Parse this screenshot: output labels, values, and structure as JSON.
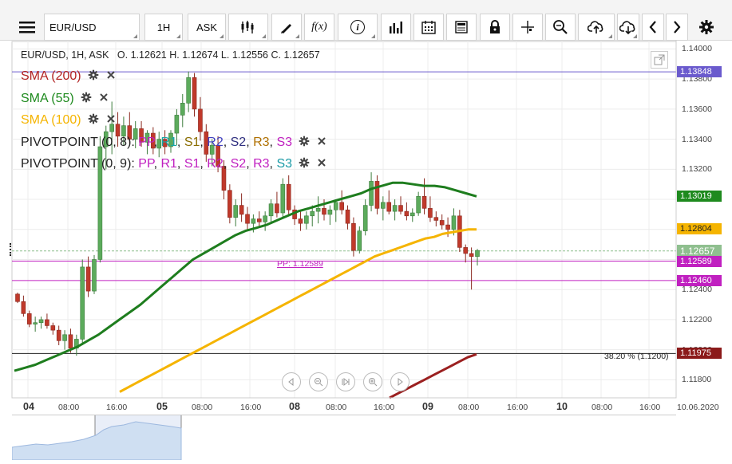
{
  "toolbar": {
    "symbol": "EUR/USD",
    "interval": "1H",
    "price_type": "ASK",
    "icons": [
      "menu-icon",
      "candlestick-icon",
      "draw-icon",
      "fx-icon",
      "info-icon",
      "volume-icon",
      "calendar-icon",
      "template-icon",
      "lock-icon",
      "crosshair-icon",
      "zoom-icon",
      "upload-icon",
      "download-icon",
      "chevron-left-icon",
      "chevron-right-icon",
      "gear-icon"
    ],
    "fx_label": "f(x)",
    "info_label": "i"
  },
  "ohlc": {
    "text": "EUR/USD, 1H, ASK",
    "open_label": "O.",
    "open": "1.12621",
    "high_label": "H.",
    "high": "1.12674",
    "low_label": "L.",
    "low": "1.12556",
    "close_label": "C.",
    "close": "1.12657"
  },
  "indicators": [
    {
      "label": "SMA (200)",
      "color": "#b22222"
    },
    {
      "label": "SMA (55)",
      "color": "#1e8a1e"
    },
    {
      "label": "SMA (100)",
      "color": "#f5b400"
    }
  ],
  "pivots": [
    {
      "prefix": "PIVOTPOINT (0, 8)",
      "parts": [
        {
          "t": ": ",
          "c": "#222"
        },
        {
          "t": "PP",
          "c": "#c020c0"
        },
        {
          "t": ", ",
          "c": "#222"
        },
        {
          "t": "R1",
          "c": "#1aa6a6"
        },
        {
          "t": ", ",
          "c": "#222"
        },
        {
          "t": "S1",
          "c": "#8a6d00"
        },
        {
          "t": ", ",
          "c": "#222"
        },
        {
          "t": "R2",
          "c": "#4040c0"
        },
        {
          "t": ", ",
          "c": "#222"
        },
        {
          "t": "S2",
          "c": "#303080"
        },
        {
          "t": ", ",
          "c": "#222"
        },
        {
          "t": "R3",
          "c": "#b07000"
        },
        {
          "t": ", ",
          "c": "#222"
        },
        {
          "t": "S3",
          "c": "#c020c0"
        }
      ]
    },
    {
      "prefix": "PIVOTPOINT (0, 9)",
      "parts": [
        {
          "t": ": ",
          "c": "#222"
        },
        {
          "t": "PP",
          "c": "#c020c0"
        },
        {
          "t": ", ",
          "c": "#222"
        },
        {
          "t": "R1",
          "c": "#c020c0"
        },
        {
          "t": ", ",
          "c": "#222"
        },
        {
          "t": "S1",
          "c": "#c020c0"
        },
        {
          "t": ", ",
          "c": "#222"
        },
        {
          "t": "R2",
          "c": "#c020c0"
        },
        {
          "t": ", ",
          "c": "#222"
        },
        {
          "t": "S2",
          "c": "#c020c0"
        },
        {
          "t": ", ",
          "c": "#222"
        },
        {
          "t": "R3",
          "c": "#c020c0"
        },
        {
          "t": ", ",
          "c": "#222"
        },
        {
          "t": "S3",
          "c": "#1a9aa6"
        }
      ]
    }
  ],
  "y_axis": {
    "ticks": [
      "1.14000",
      "1.13800",
      "1.13600",
      "1.13400",
      "1.13200",
      "1.13000",
      "1.12800",
      "1.12600",
      "1.12400",
      "1.12200",
      "1.12000",
      "1.11800"
    ],
    "range": [
      1.1168,
      1.1405
    ]
  },
  "price_tags": [
    {
      "value": "1.13848",
      "bg": "#6a5acd",
      "fg": "#ffffff"
    },
    {
      "value": "1.13019",
      "bg": "#1e8a1e",
      "fg": "#ffffff"
    },
    {
      "value": "1.12804",
      "bg": "#f5b400",
      "fg": "#222222"
    },
    {
      "value": "1.12657",
      "bg": "#8fbf8f",
      "fg": "#ffffff"
    },
    {
      "value": "1.12589",
      "bg": "#c020c0",
      "fg": "#ffffff"
    },
    {
      "value": "1.12460",
      "bg": "#c020c0",
      "fg": "#ffffff"
    },
    {
      "value": "1.11975",
      "bg": "#8b1a1a",
      "fg": "#ffffff"
    }
  ],
  "annotations": {
    "pp_label": "PP: 1.12589",
    "fib_label": "38.20 % (1.1200)"
  },
  "x_axis": {
    "labels": [
      {
        "t": "04",
        "day": true
      },
      {
        "t": "08:00",
        "day": false
      },
      {
        "t": "16:00",
        "day": false
      },
      {
        "t": "05",
        "day": true
      },
      {
        "t": "08:00",
        "day": false
      },
      {
        "t": "16:00",
        "day": false
      },
      {
        "t": "08",
        "day": true
      },
      {
        "t": "08:00",
        "day": false
      },
      {
        "t": "16:00",
        "day": false
      },
      {
        "t": "09",
        "day": true
      },
      {
        "t": "08:00",
        "day": false
      },
      {
        "t": "16:00",
        "day": false
      },
      {
        "t": "10",
        "day": true
      },
      {
        "t": "08:00",
        "day": false
      },
      {
        "t": "16:00",
        "day": false
      },
      {
        "t": "10.06.2020",
        "day": false
      }
    ]
  },
  "nav_controls": [
    "scroll-left-icon",
    "zoom-out-icon",
    "reset-icon",
    "zoom-in-icon",
    "scroll-right-icon"
  ],
  "chart_data": {
    "type": "candlestick",
    "candles": [
      [
        1.1237,
        1.1238,
        1.1231,
        1.1232
      ],
      [
        1.1232,
        1.1236,
        1.1222,
        1.1224
      ],
      [
        1.1224,
        1.1226,
        1.1215,
        1.1217
      ],
      [
        1.1217,
        1.1222,
        1.1212,
        1.1218
      ],
      [
        1.1218,
        1.1222,
        1.1214,
        1.122
      ],
      [
        1.122,
        1.1224,
        1.1214,
        1.1216
      ],
      [
        1.1216,
        1.1218,
        1.121,
        1.1213
      ],
      [
        1.1213,
        1.1216,
        1.1203,
        1.1206
      ],
      [
        1.1206,
        1.1213,
        1.12,
        1.121
      ],
      [
        1.121,
        1.1214,
        1.1198,
        1.1201
      ],
      [
        1.1201,
        1.121,
        1.1196,
        1.1207
      ],
      [
        1.1207,
        1.126,
        1.1203,
        1.1255
      ],
      [
        1.1255,
        1.1262,
        1.1235,
        1.1239
      ],
      [
        1.1239,
        1.1263,
        1.1237,
        1.126
      ],
      [
        1.126,
        1.1342,
        1.1258,
        1.1335
      ],
      [
        1.1335,
        1.1349,
        1.132,
        1.1345
      ],
      [
        1.1345,
        1.1365,
        1.133,
        1.135
      ],
      [
        1.135,
        1.1358,
        1.1335,
        1.1342
      ],
      [
        1.1342,
        1.1355,
        1.1336,
        1.1349
      ],
      [
        1.1349,
        1.1358,
        1.1337,
        1.134
      ],
      [
        1.134,
        1.1352,
        1.1334,
        1.1347
      ],
      [
        1.1347,
        1.1352,
        1.1335,
        1.1338
      ],
      [
        1.1338,
        1.1346,
        1.133,
        1.1344
      ],
      [
        1.1344,
        1.1348,
        1.133,
        1.1334
      ],
      [
        1.1334,
        1.1345,
        1.1328,
        1.134
      ],
      [
        1.134,
        1.1346,
        1.133,
        1.1335
      ],
      [
        1.1335,
        1.1346,
        1.1331,
        1.1344
      ],
      [
        1.1344,
        1.136,
        1.1336,
        1.1356
      ],
      [
        1.1356,
        1.137,
        1.1348,
        1.1364
      ],
      [
        1.1364,
        1.1385,
        1.1358,
        1.1381
      ],
      [
        1.1381,
        1.1384,
        1.1355,
        1.136
      ],
      [
        1.136,
        1.1368,
        1.1339,
        1.1345
      ],
      [
        1.1345,
        1.135,
        1.1325,
        1.133
      ],
      [
        1.133,
        1.134,
        1.1322,
        1.1336
      ],
      [
        1.1336,
        1.1342,
        1.1318,
        1.1322
      ],
      [
        1.1322,
        1.1326,
        1.13,
        1.1306
      ],
      [
        1.1306,
        1.131,
        1.1284,
        1.1288
      ],
      [
        1.1288,
        1.13,
        1.1282,
        1.1296
      ],
      [
        1.1296,
        1.1304,
        1.1285,
        1.129
      ],
      [
        1.129,
        1.1295,
        1.128,
        1.1284
      ],
      [
        1.1284,
        1.129,
        1.1278,
        1.1287
      ],
      [
        1.1287,
        1.1292,
        1.1282,
        1.1285
      ],
      [
        1.1285,
        1.1292,
        1.1279,
        1.1289
      ],
      [
        1.1289,
        1.13,
        1.1284,
        1.1297
      ],
      [
        1.1297,
        1.1305,
        1.1288,
        1.1291
      ],
      [
        1.1291,
        1.1314,
        1.1288,
        1.131
      ],
      [
        1.131,
        1.1316,
        1.129,
        1.1293
      ],
      [
        1.1293,
        1.1296,
        1.1283,
        1.1287
      ],
      [
        1.1287,
        1.1292,
        1.1279,
        1.1284
      ],
      [
        1.1284,
        1.1292,
        1.128,
        1.1289
      ],
      [
        1.1289,
        1.1296,
        1.1282,
        1.1292
      ],
      [
        1.1292,
        1.1302,
        1.1284,
        1.1294
      ],
      [
        1.1294,
        1.13,
        1.1286,
        1.129
      ],
      [
        1.129,
        1.1296,
        1.1283,
        1.1293
      ],
      [
        1.1293,
        1.13,
        1.1285,
        1.1298
      ],
      [
        1.1298,
        1.1306,
        1.129,
        1.1293
      ],
      [
        1.1293,
        1.1296,
        1.128,
        1.1284
      ],
      [
        1.1284,
        1.1288,
        1.1262,
        1.1266
      ],
      [
        1.1266,
        1.1282,
        1.1264,
        1.1279
      ],
      [
        1.1279,
        1.13,
        1.1276,
        1.1296
      ],
      [
        1.1296,
        1.1318,
        1.1292,
        1.1312
      ],
      [
        1.1312,
        1.1316,
        1.129,
        1.1294
      ],
      [
        1.1294,
        1.1302,
        1.1286,
        1.1298
      ],
      [
        1.1298,
        1.1306,
        1.129,
        1.1292
      ],
      [
        1.1292,
        1.13,
        1.1286,
        1.1296
      ],
      [
        1.1296,
        1.1302,
        1.129,
        1.1292
      ],
      [
        1.1292,
        1.1298,
        1.1286,
        1.1289
      ],
      [
        1.1289,
        1.1294,
        1.1285,
        1.1291
      ],
      [
        1.1291,
        1.1305,
        1.1289,
        1.1302
      ],
      [
        1.1302,
        1.1314,
        1.129,
        1.1294
      ],
      [
        1.1294,
        1.1302,
        1.1285,
        1.1288
      ],
      [
        1.1288,
        1.1292,
        1.1282,
        1.1286
      ],
      [
        1.1286,
        1.129,
        1.128,
        1.1283
      ],
      [
        1.1283,
        1.1288,
        1.1275,
        1.128
      ],
      [
        1.128,
        1.1294,
        1.1276,
        1.1289
      ],
      [
        1.1289,
        1.1293,
        1.1265,
        1.1268
      ],
      [
        1.1268,
        1.127,
        1.1258,
        1.1264
      ],
      [
        1.1264,
        1.1268,
        1.124,
        1.1262
      ],
      [
        1.1262,
        1.1267,
        1.1256,
        1.1266
      ]
    ],
    "sma55": [
      1.1186,
      1.1188,
      1.119,
      1.1193,
      1.1196,
      1.1199,
      1.1202,
      1.1206,
      1.121,
      1.1215,
      1.122,
      1.1225,
      1.123,
      1.1236,
      1.1242,
      1.1248,
      1.1254,
      1.126,
      1.1264,
      1.1268,
      1.1272,
      1.1276,
      1.1279,
      1.1281,
      1.1283,
      1.1286,
      1.1289,
      1.1292,
      1.1294,
      1.1296,
      1.1298,
      1.13,
      1.1302,
      1.1304,
      1.1307,
      1.1309,
      1.1311,
      1.1311,
      1.131,
      1.1309,
      1.1309,
      1.1308,
      1.1306,
      1.1304,
      1.1302
    ],
    "sma100": [
      1.1172,
      1.1175,
      1.1178,
      1.1181,
      1.1184,
      1.1187,
      1.119,
      1.1193,
      1.1196,
      1.1199,
      1.1202,
      1.1205,
      1.1208,
      1.1211,
      1.1214,
      1.1217,
      1.122,
      1.1223,
      1.1226,
      1.1229,
      1.1232,
      1.1235,
      1.1238,
      1.1241,
      1.1244,
      1.1247,
      1.125,
      1.1253,
      1.1256,
      1.1259,
      1.1262,
      1.1264,
      1.1266,
      1.1268,
      1.127,
      1.1272,
      1.1274,
      1.1275,
      1.1277,
      1.1278,
      1.1279,
      1.128,
      1.128
    ],
    "sma200": [
      1.1168,
      1.1171,
      1.1174,
      1.1177,
      1.118,
      1.1183,
      1.1186,
      1.1189,
      1.1192,
      1.1195,
      1.1197
    ],
    "levels": [
      {
        "value": 1.13848,
        "color": "#6a5acd"
      },
      {
        "value": 1.12657,
        "color": "#8fbf8f",
        "dashed": true
      },
      {
        "value": 1.12589,
        "color": "#c020c0"
      },
      {
        "value": 1.1246,
        "color": "#c020c0"
      },
      {
        "value": 1.11975,
        "color": "#222222"
      }
    ]
  }
}
